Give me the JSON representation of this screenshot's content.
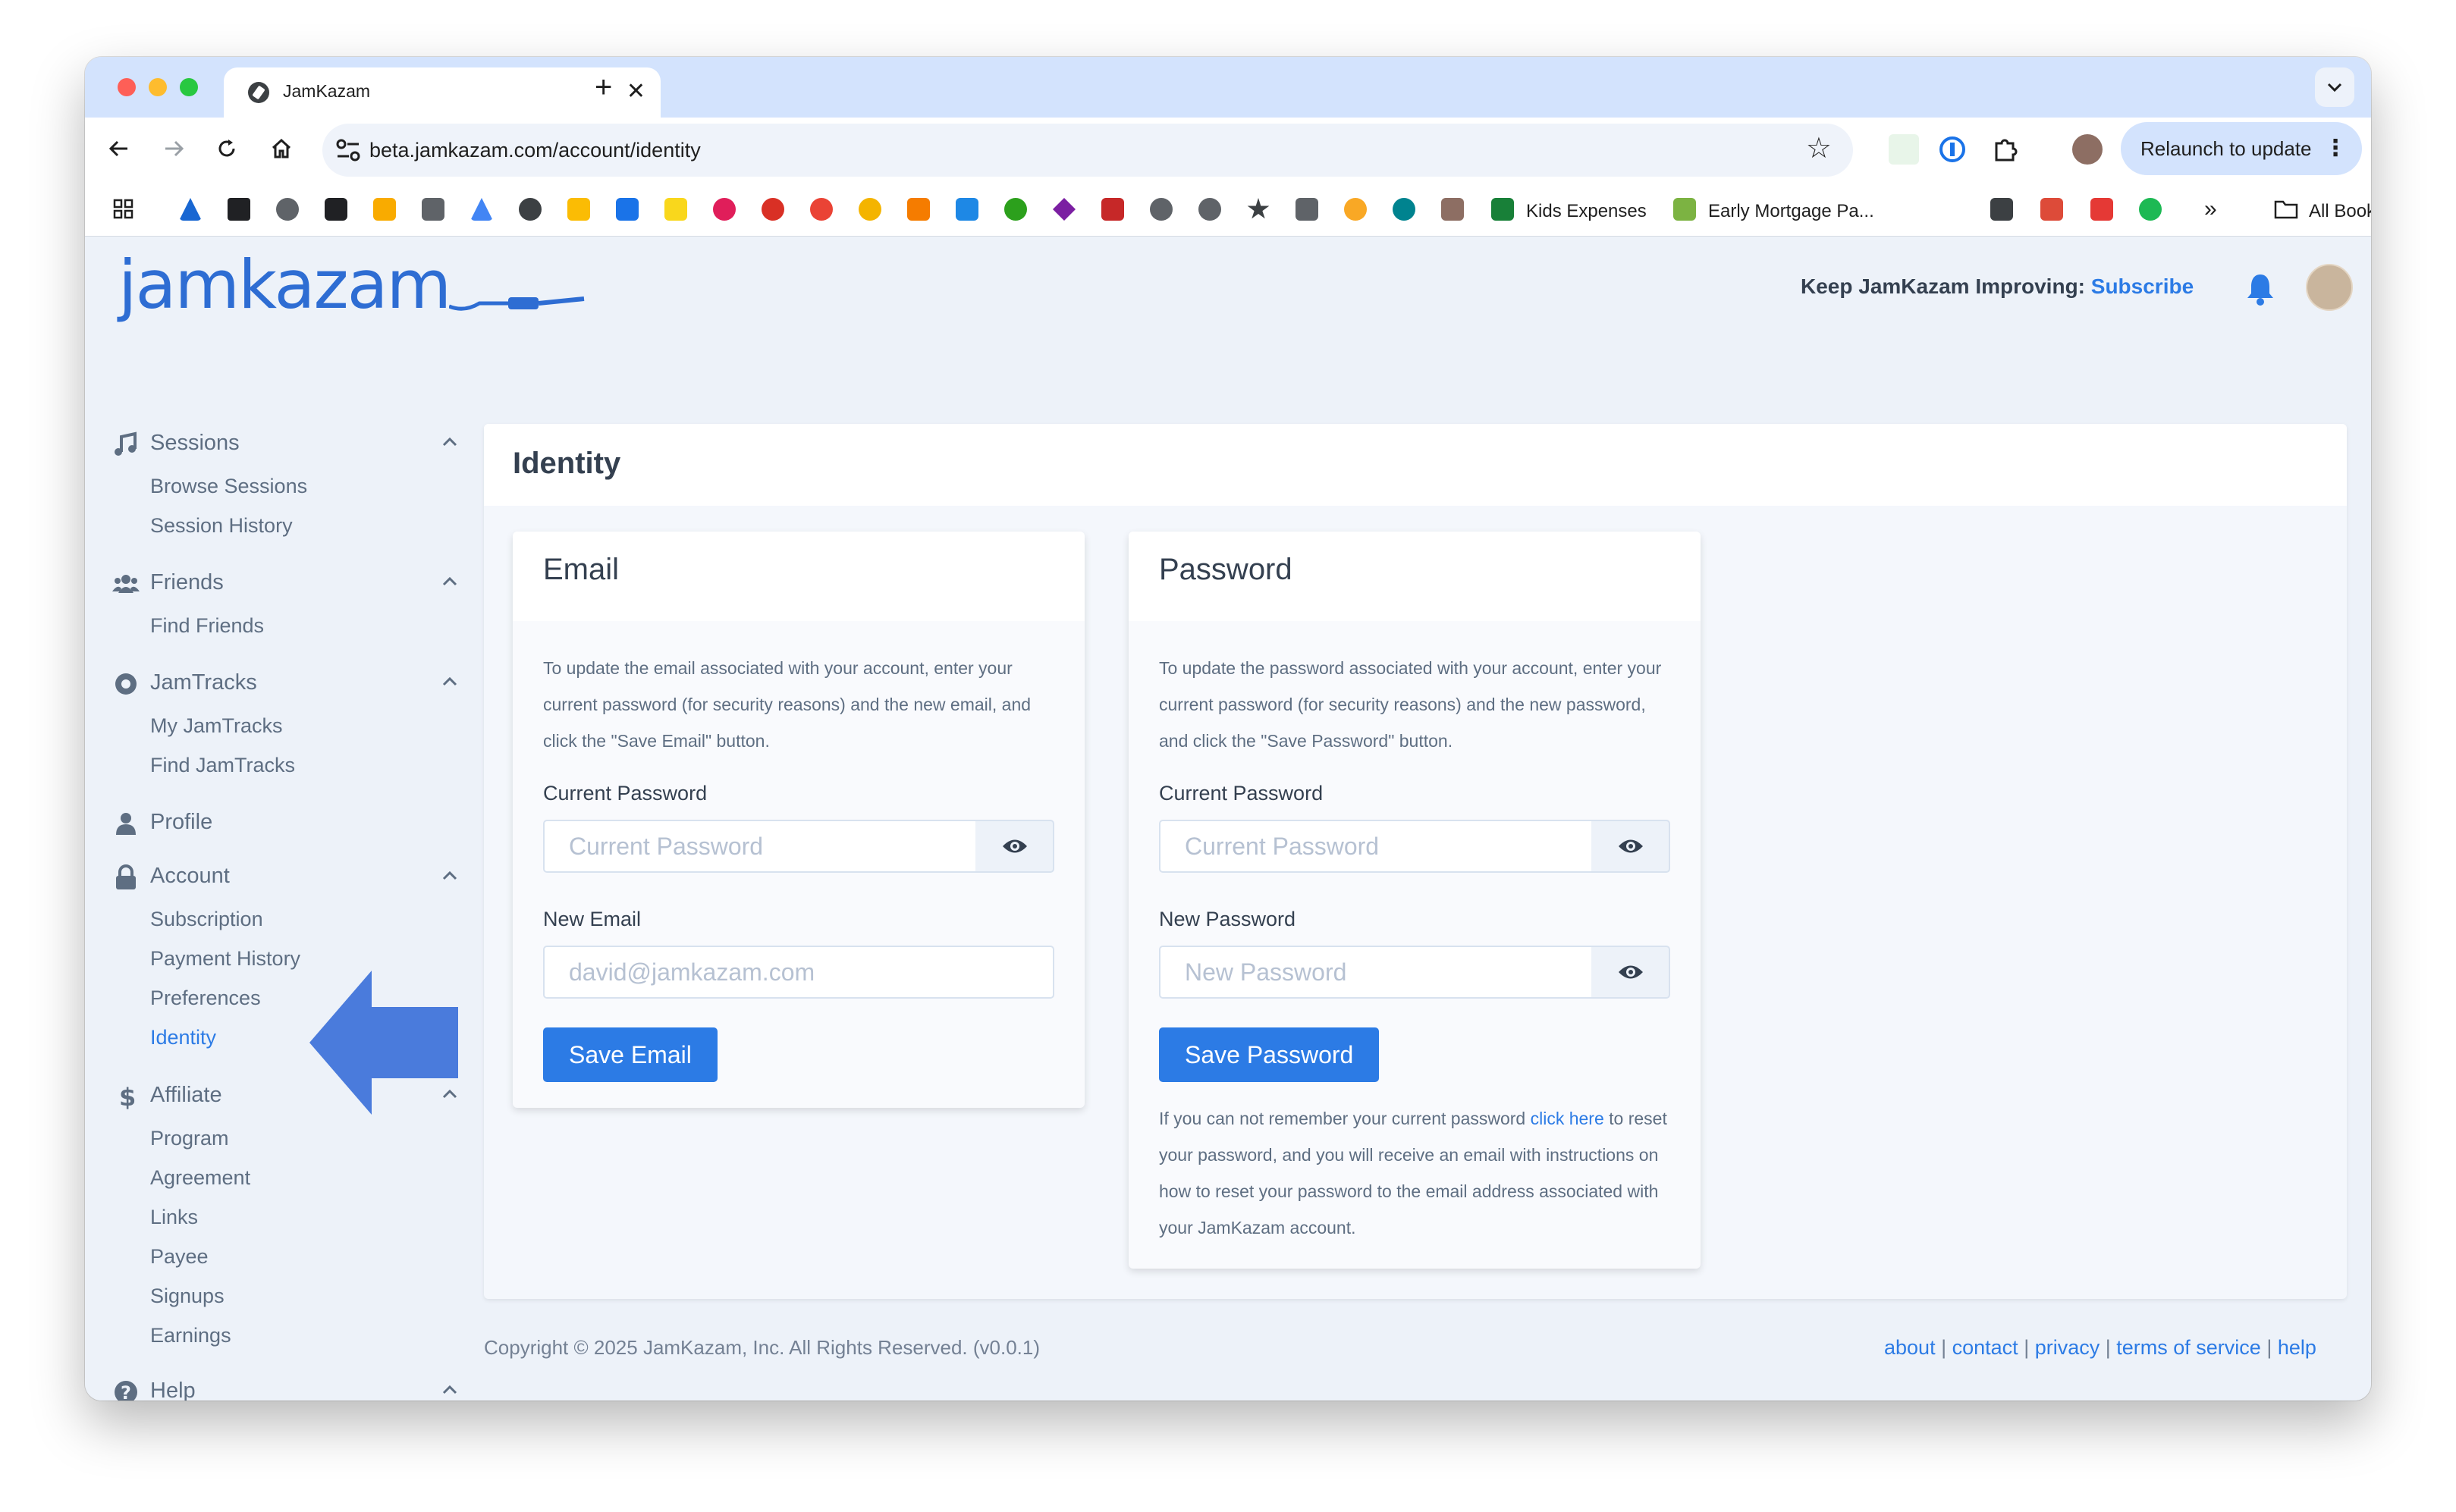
{
  "browser": {
    "tab_title": "JamKazam",
    "tab_close": "✕",
    "new_tab": "+",
    "url_host": "beta.jamkazam.com",
    "url_path": "/account/identity",
    "relaunch_label": "Relaunch to update",
    "bookmarks": {
      "kids_expenses": "Kids Expenses",
      "early_mortgage": "Early Mortgage Pa...",
      "overflow": "»",
      "all_bookmarks": "All Bookmarks"
    }
  },
  "header": {
    "logo_text": "jamkazam",
    "keep_text": "Keep JamKazam Improving: ",
    "subscribe_link": "Subscribe"
  },
  "sidebar": {
    "sessions": {
      "label": "Sessions",
      "items": [
        "Browse Sessions",
        "Session History"
      ]
    },
    "friends": {
      "label": "Friends",
      "items": [
        "Find Friends"
      ]
    },
    "jamtracks": {
      "label": "JamTracks",
      "items": [
        "My JamTracks",
        "Find JamTracks"
      ]
    },
    "profile": {
      "label": "Profile"
    },
    "account": {
      "label": "Account",
      "items": [
        "Subscription",
        "Payment History",
        "Preferences",
        "Identity"
      ]
    },
    "affiliate": {
      "label": "Affiliate",
      "items": [
        "Program",
        "Agreement",
        "Links",
        "Payee",
        "Signups",
        "Earnings"
      ]
    },
    "help": {
      "label": "Help"
    }
  },
  "main": {
    "title": "Identity",
    "email_card": {
      "title": "Email",
      "description": "To update the email associated with your account, enter your current password (for security reasons) and the new email, and click the \"Save Email\" button.",
      "current_password_label": "Current Password",
      "current_password_placeholder": "Current Password",
      "new_email_label": "New Email",
      "new_email_placeholder": "david@jamkazam.com",
      "save_label": "Save Email"
    },
    "password_card": {
      "title": "Password",
      "description": "To update the password associated with your account, enter your current password (for security reasons) and the new password, and click the \"Save Password\" button.",
      "current_password_label": "Current Password",
      "current_password_placeholder": "Current Password",
      "new_password_label": "New Password",
      "new_password_placeholder": "New Password",
      "save_label": "Save Password",
      "forgot_before": "If you can not remember your current password ",
      "forgot_link": "click here",
      "forgot_after": " to reset your password, and you will receive an email with instructions on how to reset your password to the email address associated with your JamKazam account."
    }
  },
  "footer": {
    "copyright": "Copyright © 2025 JamKazam, Inc. All Rights Reserved.  (v0.0.1)",
    "about": "about",
    "contact": "contact",
    "privacy": "privacy",
    "terms": "terms of service",
    "help": "help"
  },
  "colors": {
    "accent": "#2c7be5",
    "text": "#344050",
    "muted": "#5e6e82",
    "page_bg": "#edf2f9",
    "annotation_arrow": "#4a7bdc"
  }
}
